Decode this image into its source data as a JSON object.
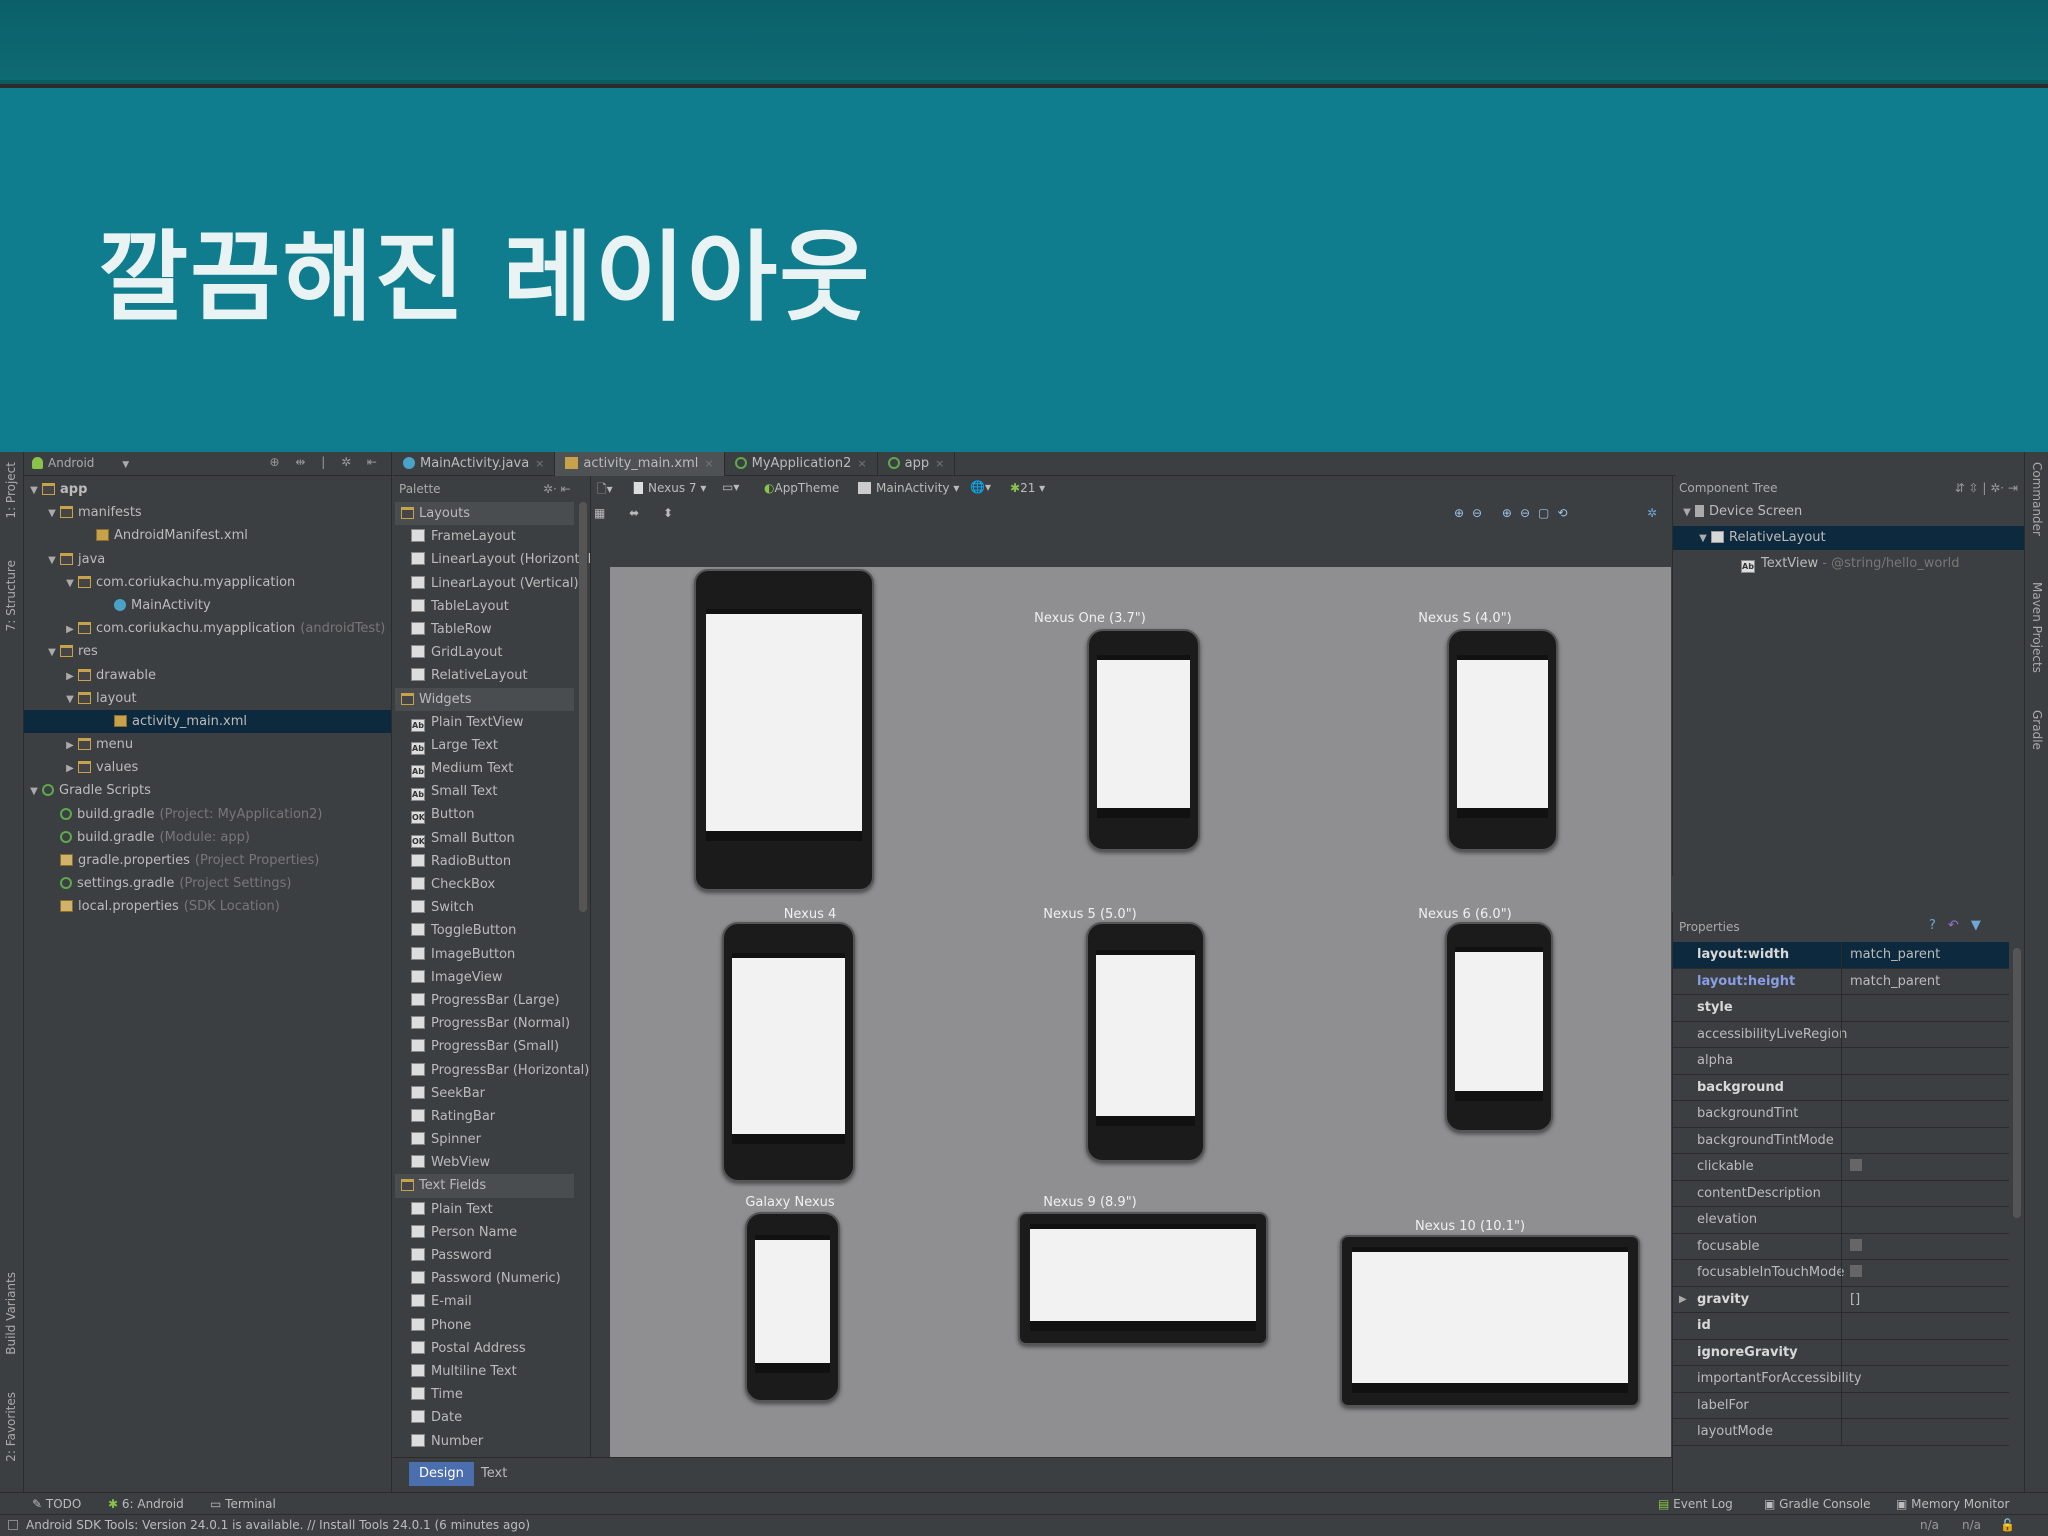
{
  "slide": {
    "title": "깔끔해진 레이아웃"
  },
  "left_strip": {
    "project": "1: Project",
    "structure": "7: Structure",
    "build_variants": "Build Variants",
    "favorites": "2: Favorites"
  },
  "right_strip": {
    "commander": "Commander",
    "maven": "Maven Projects",
    "gradle": "Gradle"
  },
  "project": {
    "view": "Android",
    "tree": [
      {
        "label": "app",
        "note": "",
        "indent": 0,
        "arrow": "▼",
        "icon": "folder",
        "bold": true
      },
      {
        "label": "manifests",
        "note": "",
        "indent": 1,
        "arrow": "▼",
        "icon": "folder"
      },
      {
        "label": "AndroidManifest.xml",
        "note": "",
        "indent": 3,
        "arrow": "",
        "icon": "xml"
      },
      {
        "label": "java",
        "note": "",
        "indent": 1,
        "arrow": "▼",
        "icon": "folder"
      },
      {
        "label": "com.coriukachu.myapplication",
        "note": "",
        "indent": 2,
        "arrow": "▼",
        "icon": "folder"
      },
      {
        "label": "MainActivity",
        "note": "",
        "indent": 4,
        "arrow": "",
        "icon": "class"
      },
      {
        "label": "com.coriukachu.myapplication",
        "note": "(androidTest)",
        "indent": 2,
        "arrow": "▶",
        "icon": "folder"
      },
      {
        "label": "res",
        "note": "",
        "indent": 1,
        "arrow": "▼",
        "icon": "folder"
      },
      {
        "label": "drawable",
        "note": "",
        "indent": 2,
        "arrow": "▶",
        "icon": "folder"
      },
      {
        "label": "layout",
        "note": "",
        "indent": 2,
        "arrow": "▼",
        "icon": "folder"
      },
      {
        "label": "activity_main.xml",
        "note": "",
        "indent": 4,
        "arrow": "",
        "icon": "xml",
        "selected": true
      },
      {
        "label": "menu",
        "note": "",
        "indent": 2,
        "arrow": "▶",
        "icon": "folder"
      },
      {
        "label": "values",
        "note": "",
        "indent": 2,
        "arrow": "▶",
        "icon": "folder"
      },
      {
        "label": "Gradle Scripts",
        "note": "",
        "indent": 0,
        "arrow": "▼",
        "icon": "gradle"
      },
      {
        "label": "build.gradle",
        "note": "(Project: MyApplication2)",
        "indent": 1,
        "arrow": "",
        "icon": "gradle"
      },
      {
        "label": "build.gradle",
        "note": "(Module: app)",
        "indent": 1,
        "arrow": "",
        "icon": "gradle"
      },
      {
        "label": "gradle.properties",
        "note": "(Project Properties)",
        "indent": 1,
        "arrow": "",
        "icon": "props"
      },
      {
        "label": "settings.gradle",
        "note": "(Project Settings)",
        "indent": 1,
        "arrow": "",
        "icon": "gradle"
      },
      {
        "label": "local.properties",
        "note": "(SDK Location)",
        "indent": 1,
        "arrow": "",
        "icon": "props"
      }
    ]
  },
  "tabs": [
    {
      "label": "MainActivity.java",
      "active": false
    },
    {
      "label": "activity_main.xml",
      "active": true
    },
    {
      "label": "MyApplication2",
      "active": false
    },
    {
      "label": "app",
      "active": false
    }
  ],
  "palette": {
    "title": "Palette",
    "sections": [
      {
        "name": "Layouts",
        "items": [
          "FrameLayout",
          "LinearLayout (Horizontal)",
          "LinearLayout (Vertical)",
          "TableLayout",
          "TableRow",
          "GridLayout",
          "RelativeLayout"
        ]
      },
      {
        "name": "Widgets",
        "items": [
          "Plain TextView",
          "Large Text",
          "Medium Text",
          "Small Text",
          "Button",
          "Small Button",
          "RadioButton",
          "CheckBox",
          "Switch",
          "ToggleButton",
          "ImageButton",
          "ImageView",
          "ProgressBar (Large)",
          "ProgressBar (Normal)",
          "ProgressBar (Small)",
          "ProgressBar (Horizontal)",
          "SeekBar",
          "RatingBar",
          "Spinner",
          "WebView"
        ]
      },
      {
        "name": "Text Fields",
        "items": [
          "Plain Text",
          "Person Name",
          "Password",
          "Password (Numeric)",
          "E-mail",
          "Phone",
          "Postal Address",
          "Multiline Text",
          "Time",
          "Date",
          "Number"
        ]
      }
    ]
  },
  "design_toolbar": {
    "device": "Nexus 7",
    "theme": "AppTheme",
    "activity": "MainActivity",
    "api": "21"
  },
  "devices": [
    {
      "label": "Nexus One (3.7\")"
    },
    {
      "label": "Nexus S (4.0\")"
    },
    {
      "label": "Nexus 4"
    },
    {
      "label": "Nexus 5 (5.0\")"
    },
    {
      "label": "Nexus 6 (6.0\")"
    },
    {
      "label": "Galaxy Nexus"
    },
    {
      "label": "Nexus 9 (8.9\")"
    },
    {
      "label": "Nexus 10 (10.1\")"
    }
  ],
  "editor_tabs": {
    "design": "Design",
    "text": "Text"
  },
  "component_tree": {
    "title": "Component Tree",
    "device_screen": "Device Screen",
    "relative_layout": "RelativeLayout",
    "textview": "TextView",
    "textview_note": "- @string/hello_world"
  },
  "properties": {
    "title": "Properties",
    "rows": [
      {
        "name": "layout:width",
        "value": "match_parent",
        "bold": true,
        "selected": true
      },
      {
        "name": "layout:height",
        "value": "match_parent",
        "bold": true,
        "link": true
      },
      {
        "name": "style",
        "value": "",
        "bold": true
      },
      {
        "name": "accessibilityLiveRegion",
        "value": ""
      },
      {
        "name": "alpha",
        "value": ""
      },
      {
        "name": "background",
        "value": "",
        "bold": true
      },
      {
        "name": "backgroundTint",
        "value": ""
      },
      {
        "name": "backgroundTintMode",
        "value": ""
      },
      {
        "name": "clickable",
        "value": "",
        "checkbox": true
      },
      {
        "name": "contentDescription",
        "value": ""
      },
      {
        "name": "elevation",
        "value": ""
      },
      {
        "name": "focusable",
        "value": "",
        "checkbox": true
      },
      {
        "name": "focusableInTouchMode",
        "value": "",
        "checkbox": true
      },
      {
        "name": "gravity",
        "value": "[]",
        "bold": true,
        "expand": true
      },
      {
        "name": "id",
        "value": "",
        "bold": true
      },
      {
        "name": "ignoreGravity",
        "value": "",
        "bold": true
      },
      {
        "name": "importantForAccessibility",
        "value": ""
      },
      {
        "name": "labelFor",
        "value": ""
      },
      {
        "name": "layoutMode",
        "value": ""
      }
    ]
  },
  "bottom_tools": {
    "todo": "TODO",
    "android": "6: Android",
    "terminal": "Terminal",
    "event_log": "Event Log",
    "gradle_console": "Gradle Console",
    "memory_monitor": "Memory Monitor"
  },
  "status": {
    "message": "Android SDK Tools: Version 24.0.1 is available. // Install Tools 24.0.1 (6 minutes ago)",
    "pos1": "n/a",
    "pos2": "n/a"
  },
  "colors": {
    "slide_band": "#0f7d8d",
    "ide_bg": "#3c3f41",
    "selection": "#0d293e",
    "accent": "#4b6eaf"
  }
}
